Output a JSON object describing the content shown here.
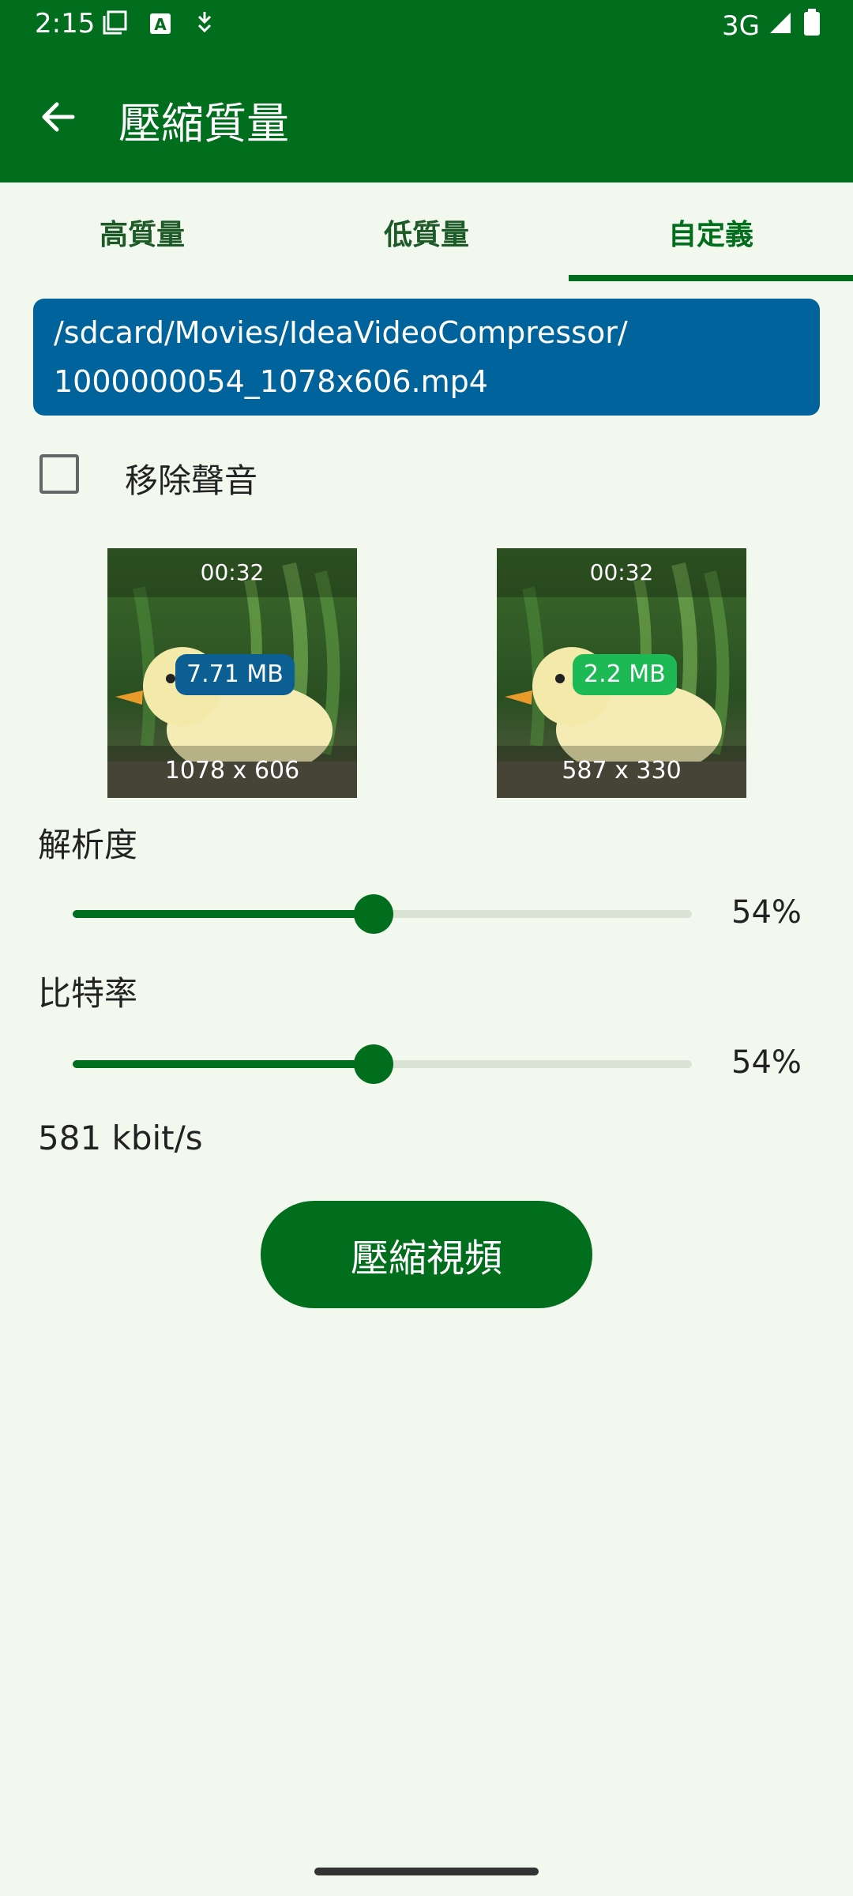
{
  "status_bar": {
    "time": "2:15",
    "network": "3G",
    "icons": [
      "screenshot-icon",
      "a-box-icon",
      "download-icon",
      "signal-icon",
      "battery-icon"
    ]
  },
  "app_bar": {
    "title": "壓縮質量",
    "color": "#006e1c"
  },
  "tabs": [
    {
      "label": "高質量",
      "active": false
    },
    {
      "label": "低質量",
      "active": false
    },
    {
      "label": "自定義",
      "active": true
    }
  ],
  "file_path": "/sdcard/Movies/IdeaVideoCompressor/\n1000000054_1078x606.mp4",
  "remove_audio": {
    "label": "移除聲音",
    "checked": false
  },
  "thumbnails": [
    {
      "duration": "00:32",
      "size": "7.71 MB",
      "resolution": "1078 x 606",
      "badge_color": "#0b5f93"
    },
    {
      "duration": "00:32",
      "size": "2.2 MB",
      "resolution": "587 x 330",
      "badge_color": "#1db954"
    }
  ],
  "resolution_slider": {
    "label": "解析度",
    "value_text": "54%",
    "value_fraction": 0.54
  },
  "bitrate_slider": {
    "label": "比特率",
    "value_text": "54%",
    "value_fraction": 0.54
  },
  "bitrate_text": "581 kbit/s",
  "compress_button": "壓縮視頻"
}
